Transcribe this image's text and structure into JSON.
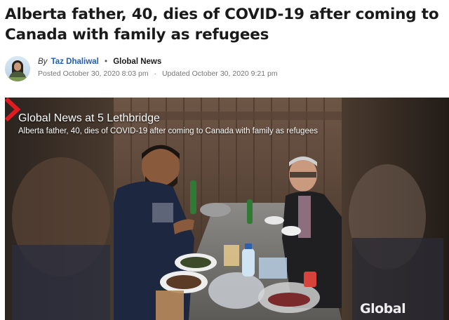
{
  "article": {
    "headline": "Alberta father, 40, dies of COVID-19 after coming to Canada with family as refugees",
    "byline": {
      "by": "By",
      "author": "Taz Dhaliwal",
      "separator": "•",
      "organization": "Global News",
      "posted": "Posted October 30, 2020 8:03 pm",
      "date_separator": "·",
      "updated": "Updated October 30, 2020 9:21 pm"
    }
  },
  "video": {
    "title": "Global News at 5 Lethbridge",
    "subtitle": "Alberta father, 40, dies of COVID-19 after coming to Canada with family as refugees",
    "logo_text": "Global",
    "logo_color": "#e01b22"
  }
}
